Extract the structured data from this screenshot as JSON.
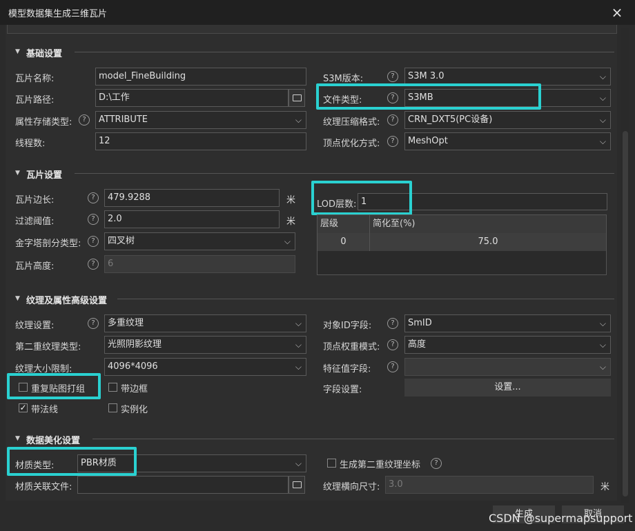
{
  "window": {
    "title": "模型数据集生成三维瓦片",
    "close_icon": "×"
  },
  "sections": {
    "basic": "基础设置",
    "tile": "瓦片设置",
    "texture": "纹理及属性高级设置",
    "beautify": "数据美化设置"
  },
  "basic": {
    "tile_name_label": "瓦片名称:",
    "tile_name_value": "model_FineBuilding",
    "tile_path_label": "瓦片路径:",
    "tile_path_value": "D:\\工作",
    "attr_storage_label": "属性存储类型:",
    "attr_storage_value": "ATTRIBUTE",
    "threads_label": "线程数:",
    "threads_value": "12",
    "s3m_version_label": "S3M版本:",
    "s3m_version_value": "S3M 3.0",
    "file_type_label": "文件类型:",
    "file_type_value": "S3MB",
    "tex_compress_label": "纹理压缩格式:",
    "tex_compress_value": "CRN_DXT5(PC设备)",
    "vertex_opt_label": "顶点优化方式:",
    "vertex_opt_value": "MeshOpt"
  },
  "tile": {
    "edge_label": "瓦片边长:",
    "edge_value": "479.9288",
    "edge_unit": "米",
    "filter_label": "过滤阈值:",
    "filter_value": "2.0",
    "filter_unit": "米",
    "pyramid_label": "金字塔剖分类型:",
    "pyramid_value": "四叉树",
    "height_label": "瓦片高度:",
    "height_value": "6",
    "lod_label": "LOD层数:",
    "lod_value": "1",
    "table_headers": [
      "层级",
      "简化至(%)"
    ],
    "table_rows": [
      [
        "0",
        "75.0"
      ]
    ]
  },
  "texture": {
    "tex_setting_label": "纹理设置:",
    "tex_setting_value": "多重纹理",
    "second_tex_label": "第二重纹理类型:",
    "second_tex_value": "光照阴影纹理",
    "tex_size_label": "纹理大小限制:",
    "tex_size_value": "4096*4096",
    "repeat_group_label": "重复贴图打组",
    "edge_frame_label": "带边框",
    "normal_label": "带法线",
    "instancing_label": "实例化",
    "obj_id_label": "对象ID字段:",
    "obj_id_value": "SmID",
    "vertex_weight_label": "顶点权重模式:",
    "vertex_weight_value": "高度",
    "feature_field_label": "特征值字段:",
    "feature_field_value": "",
    "field_setting_label": "字段设置:",
    "field_setting_button": "设置..."
  },
  "beautify": {
    "material_label": "材质类型:",
    "material_value": "PBR材质",
    "material_file_label": "材质关联文件:",
    "material_file_value": "",
    "gen_second_uv_label": "生成第二重纹理坐标",
    "tex_hsize_label": "纹理横向尺寸:",
    "tex_hsize_value": "3.0",
    "tex_hsize_unit": "米"
  },
  "footer": {
    "generate": "生成",
    "cancel": "取消"
  },
  "help_icon": "?",
  "watermark": "CSDN @supermapsupport",
  "colors": {
    "highlight": "#2ad1d1",
    "background": "#2b2b2b"
  }
}
